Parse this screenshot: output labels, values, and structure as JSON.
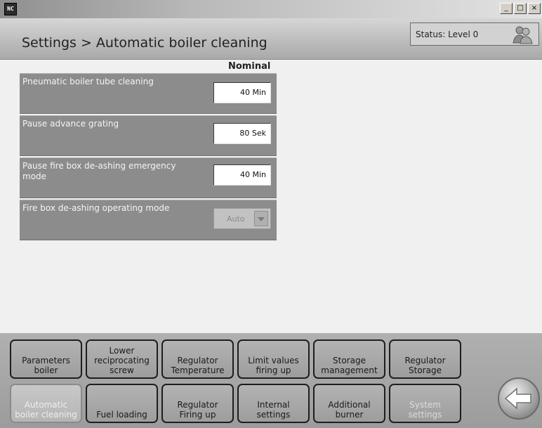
{
  "window": {
    "app_icon": "NC",
    "min_label": "_",
    "max_label": "□",
    "close_label": "×"
  },
  "header": {
    "breadcrumb": "Settings > Automatic boiler cleaning",
    "status": "Status: Level 0",
    "status_icon": "users-icon"
  },
  "main": {
    "column_header": "Nominal",
    "params": [
      {
        "label": "Pneumatic boiler tube cleaning",
        "value": "40 Min"
      },
      {
        "label": "Pause advance grating",
        "value": "80 Sek"
      },
      {
        "label": "Pause fire box de-ashing emergency mode",
        "value": "40 Min"
      },
      {
        "label": "Fire box de-ashing operating mode",
        "value": "Auto",
        "type": "dropdown",
        "disabled": true
      }
    ]
  },
  "nav": {
    "row1": [
      {
        "label": "Parameters\nboiler"
      },
      {
        "label": "Lower\nreciprocating\nscrew"
      },
      {
        "label": "Regulator\nTemperature"
      },
      {
        "label": "Limit values\nfiring up"
      },
      {
        "label": "Storage\nmanagement"
      },
      {
        "label": "Regulator\nStorage"
      }
    ],
    "row2": [
      {
        "label": "Automatic\nboiler cleaning",
        "state": "active"
      },
      {
        "label": "Fuel loading"
      },
      {
        "label": "Regulator\nFiring up"
      },
      {
        "label": "Internal\nsettings"
      },
      {
        "label": "Additional\nburner"
      },
      {
        "label": "System\nsettings",
        "state": "disabled"
      }
    ],
    "back_icon": "back-arrow-icon"
  }
}
